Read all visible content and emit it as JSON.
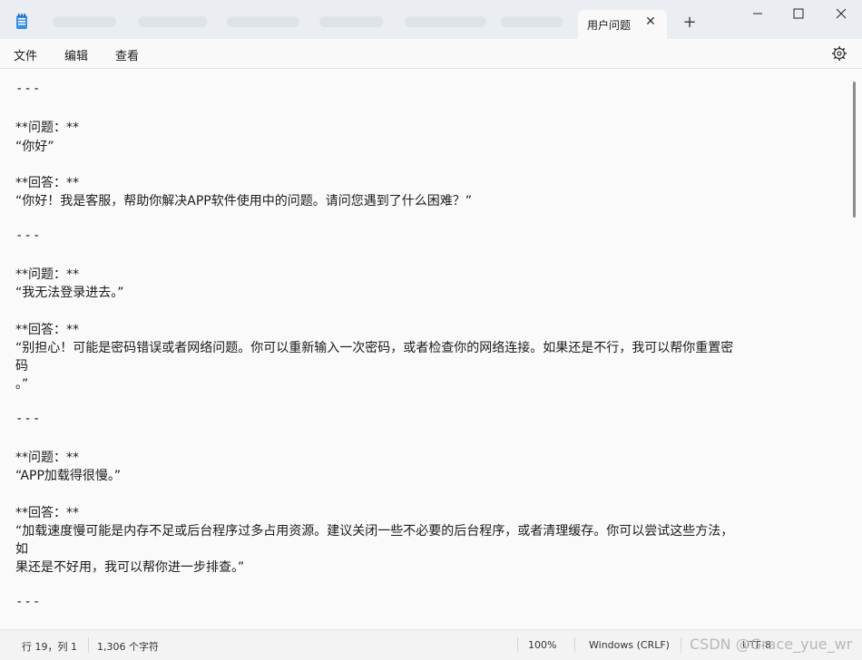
{
  "window": {
    "active_tab_label": "用户问题",
    "tab_close_glyph": "✕",
    "new_tab_glyph": "+",
    "controls": [
      "minimize",
      "maximize",
      "close"
    ]
  },
  "menu": {
    "file": "文件",
    "edit": "编辑",
    "view": "查看"
  },
  "editor": {
    "lines": [
      "---",
      "",
      "**问题：**",
      "“你好”",
      "",
      "**回答：**",
      "“你好！我是客服，帮助你解决APP软件使用中的问题。请问您遇到了什么困难？”",
      "",
      "---",
      "",
      "**问题：**",
      "“我无法登录进去。”",
      "",
      "**回答：**",
      "“别担心！可能是密码错误或者网络问题。你可以重新输入一次密码，或者检查你的网络连接。如果还是不行，我可以帮你重置密",
      "码",
      "。”",
      "",
      "---",
      "",
      "**问题：**",
      "“APP加载得很慢。”",
      "",
      "**回答：**",
      "“加载速度慢可能是内存不足或后台程序过多占用资源。建议关闭一些不必要的后台程序，或者清理缓存。你可以尝试这些方法，",
      "如",
      "果还是不好用，我可以帮你进一步排查。”",
      "",
      "---"
    ]
  },
  "status": {
    "position": "行 19，列 1",
    "char_count": "1,306 个字符",
    "zoom": "100%",
    "line_ending": "Windows (CRLF)",
    "encoding": "UTF-8"
  },
  "watermark": "CSDN @Grace_yue_wr",
  "colors": {
    "titlebar": "#eaeef2",
    "editor_bg": "#fafafa",
    "text": "#1a1a1a"
  }
}
